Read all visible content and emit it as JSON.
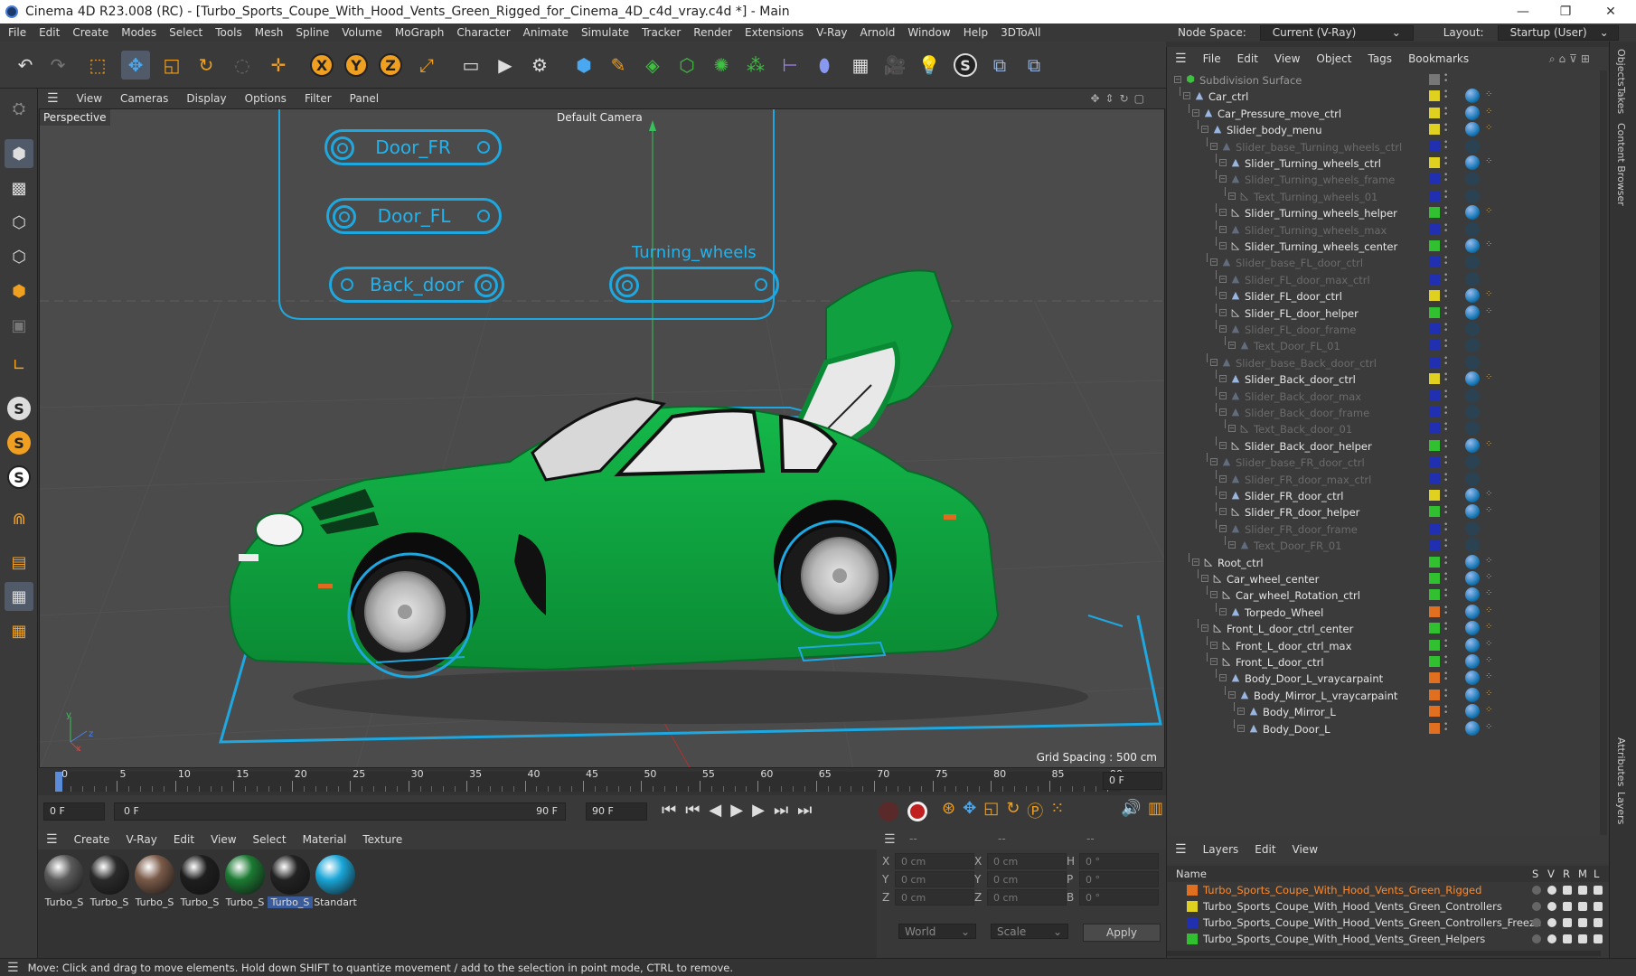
{
  "window": {
    "title": "Cinema 4D R23.008 (RC) - [Turbo_Sports_Coupe_With_Hood_Vents_Green_Rigged_for_Cinema_4D_c4d_vray.c4d *] - Main",
    "minimize": "—",
    "maximize": "❐",
    "close": "✕"
  },
  "menubar": {
    "items": [
      "File",
      "Edit",
      "Create",
      "Modes",
      "Select",
      "Tools",
      "Mesh",
      "Spline",
      "Volume",
      "MoGraph",
      "Character",
      "Animate",
      "Simulate",
      "Tracker",
      "Render",
      "Extensions",
      "V-Ray",
      "Arnold",
      "Window",
      "Help",
      "3DToAll"
    ],
    "node_space_label": "Node Space:",
    "node_space_value": "Current (V-Ray)",
    "layout_label": "Layout:",
    "layout_value": "Startup (User)"
  },
  "viewport": {
    "menu": [
      "View",
      "Cameras",
      "Display",
      "Options",
      "Filter",
      "Panel"
    ],
    "name": "Perspective",
    "camera": "Default Camera",
    "grid_spacing": "Grid Spacing : 500 cm",
    "controls": {
      "door_fr": "Door_FR",
      "door_fl": "Door_FL",
      "back_door": "Back_door",
      "turning_wheels": "Turning_wheels"
    }
  },
  "timeline": {
    "ticks": [
      "0",
      "5",
      "10",
      "15",
      "20",
      "25",
      "30",
      "35",
      "40",
      "45",
      "50",
      "55",
      "60",
      "65",
      "70",
      "75",
      "80",
      "85",
      "90"
    ],
    "current_frame": "0 F",
    "start_frame": "0 F",
    "range_start": "0 F",
    "range_end": "90 F",
    "end_frame": "90 F"
  },
  "materials": {
    "menu": [
      "Create",
      "V-Ray",
      "Edit",
      "View",
      "Select",
      "Material",
      "Texture"
    ],
    "items": [
      {
        "label": "Turbo_S",
        "color": "#5a5a5a"
      },
      {
        "label": "Turbo_S",
        "color": "#2a2a2a"
      },
      {
        "label": "Turbo_S",
        "color": "#7a5a48"
      },
      {
        "label": "Turbo_S",
        "color": "#1e1e1e"
      },
      {
        "label": "Turbo_S",
        "color": "#1b7a32"
      },
      {
        "label": "Turbo_S",
        "color": "#222222"
      },
      {
        "label": "Standart",
        "color": "#1aa6d8"
      }
    ],
    "selected_index": 5
  },
  "coords": {
    "header": "--",
    "header2": "--",
    "header3": "--",
    "rows": [
      {
        "a": "X",
        "av": "0 cm",
        "b": "X",
        "bv": "0 cm",
        "c": "H",
        "cv": "0 °"
      },
      {
        "a": "Y",
        "av": "0 cm",
        "b": "Y",
        "bv": "0 cm",
        "c": "P",
        "cv": "0 °"
      },
      {
        "a": "Z",
        "av": "0 cm",
        "b": "Z",
        "bv": "0 cm",
        "c": "B",
        "cv": "0 °"
      }
    ],
    "world": "World",
    "scale": "Scale",
    "apply": "Apply"
  },
  "status": "Move: Click and drag to move elements. Hold down SHIFT to quantize movement / add to the selection in point mode, CTRL to remove.",
  "object_manager": {
    "menu": [
      "File",
      "Edit",
      "View",
      "Object",
      "Tags",
      "Bookmarks"
    ],
    "rows": [
      {
        "name": "Subdivision Surface",
        "depth": 0,
        "dim": false,
        "layer": "#888888",
        "icon": "subd"
      },
      {
        "name": "Car_ctrl",
        "depth": 1,
        "dim": false,
        "layer": "#e0d020",
        "icon": "null"
      },
      {
        "name": "Car_Pressure_move_ctrl",
        "depth": 2,
        "dim": false,
        "layer": "#e0d020",
        "icon": "null"
      },
      {
        "name": "Slider_body_menu",
        "depth": 3,
        "dim": false,
        "layer": "#e0d020",
        "icon": "null"
      },
      {
        "name": "Slider_base_Turning_wheels_ctrl",
        "depth": 4,
        "dim": true,
        "layer": "#2030b0",
        "icon": "null"
      },
      {
        "name": "Slider_Turning_wheels_ctrl",
        "depth": 5,
        "dim": false,
        "layer": "#e0d020",
        "icon": "null"
      },
      {
        "name": "Slider_Turning_wheels_frame",
        "depth": 5,
        "dim": true,
        "layer": "#2030b0",
        "icon": "null"
      },
      {
        "name": "Text_Turning_wheels_01",
        "depth": 6,
        "dim": true,
        "layer": "#2030b0",
        "icon": "spline"
      },
      {
        "name": "Slider_Turning_wheels_helper",
        "depth": 5,
        "dim": false,
        "layer": "#30c030",
        "icon": "spline"
      },
      {
        "name": "Slider_Turning_wheels_max",
        "depth": 5,
        "dim": true,
        "layer": "#2030b0",
        "icon": "null"
      },
      {
        "name": "Slider_Turning_wheels_center",
        "depth": 5,
        "dim": false,
        "layer": "#30c030",
        "icon": "spline"
      },
      {
        "name": "Slider_base_FL_door_ctrl",
        "depth": 4,
        "dim": true,
        "layer": "#2030b0",
        "icon": "null"
      },
      {
        "name": "Slider_FL_door_max_ctrl",
        "depth": 5,
        "dim": true,
        "layer": "#2030b0",
        "icon": "null"
      },
      {
        "name": "Slider_FL_door_ctrl",
        "depth": 5,
        "dim": false,
        "layer": "#e0d020",
        "icon": "null"
      },
      {
        "name": "Slider_FL_door_helper",
        "depth": 5,
        "dim": false,
        "layer": "#30c030",
        "icon": "spline"
      },
      {
        "name": "Slider_FL_door_frame",
        "depth": 5,
        "dim": true,
        "layer": "#2030b0",
        "icon": "null"
      },
      {
        "name": "Text_Door_FL_01",
        "depth": 6,
        "dim": true,
        "layer": "#2030b0",
        "icon": "null"
      },
      {
        "name": "Slider_base_Back_door_ctrl",
        "depth": 4,
        "dim": true,
        "layer": "#2030b0",
        "icon": "null"
      },
      {
        "name": "Slider_Back_door_ctrl",
        "depth": 5,
        "dim": false,
        "layer": "#e0d020",
        "icon": "null"
      },
      {
        "name": "Slider_Back_door_max",
        "depth": 5,
        "dim": true,
        "layer": "#2030b0",
        "icon": "null"
      },
      {
        "name": "Slider_Back_door_frame",
        "depth": 5,
        "dim": true,
        "layer": "#2030b0",
        "icon": "null"
      },
      {
        "name": "Text_Back_door_01",
        "depth": 6,
        "dim": true,
        "layer": "#2030b0",
        "icon": "spline"
      },
      {
        "name": "Slider_Back_door_helper",
        "depth": 5,
        "dim": false,
        "layer": "#30c030",
        "icon": "spline"
      },
      {
        "name": "Slider_base_FR_door_ctrl",
        "depth": 4,
        "dim": true,
        "layer": "#2030b0",
        "icon": "null"
      },
      {
        "name": "Slider_FR_door_max_ctrl",
        "depth": 5,
        "dim": true,
        "layer": "#2030b0",
        "icon": "null"
      },
      {
        "name": "Slider_FR_door_ctrl",
        "depth": 5,
        "dim": false,
        "layer": "#e0d020",
        "icon": "null"
      },
      {
        "name": "Slider_FR_door_helper",
        "depth": 5,
        "dim": false,
        "layer": "#30c030",
        "icon": "spline"
      },
      {
        "name": "Slider_FR_door_frame",
        "depth": 5,
        "dim": true,
        "layer": "#2030b0",
        "icon": "null"
      },
      {
        "name": "Text_Door_FR_01",
        "depth": 6,
        "dim": true,
        "layer": "#2030b0",
        "icon": "null"
      },
      {
        "name": "Root_ctrl",
        "depth": 2,
        "dim": false,
        "layer": "#30c030",
        "icon": "spline"
      },
      {
        "name": "Car_wheel_center",
        "depth": 3,
        "dim": false,
        "layer": "#30c030",
        "icon": "spline"
      },
      {
        "name": "Car_wheel_Rotation_ctrl",
        "depth": 4,
        "dim": false,
        "layer": "#30c030",
        "icon": "spline"
      },
      {
        "name": "Torpedo_Wheel",
        "depth": 5,
        "dim": false,
        "layer": "#e07020",
        "icon": "null"
      },
      {
        "name": "Front_L_door_ctrl_center",
        "depth": 3,
        "dim": false,
        "layer": "#30c030",
        "icon": "spline"
      },
      {
        "name": "Front_L_door_ctrl_max",
        "depth": 4,
        "dim": false,
        "layer": "#30c030",
        "icon": "spline"
      },
      {
        "name": "Front_L_door_ctrl",
        "depth": 4,
        "dim": false,
        "layer": "#30c030",
        "icon": "spline"
      },
      {
        "name": "Body_Door_L_vraycarpaint",
        "depth": 5,
        "dim": false,
        "layer": "#e07020",
        "icon": "null"
      },
      {
        "name": "Body_Mirror_L_vraycarpaint",
        "depth": 6,
        "dim": false,
        "layer": "#e07020",
        "icon": "null"
      },
      {
        "name": "Body_Mirror_L",
        "depth": 7,
        "dim": false,
        "layer": "#e07020",
        "icon": "null"
      },
      {
        "name": "Body_Door_L",
        "depth": 7,
        "dim": false,
        "layer": "#e07020",
        "icon": "null"
      }
    ]
  },
  "layers": {
    "menu": [
      "Layers",
      "Edit",
      "View"
    ],
    "col_name": "Name",
    "cols": [
      "S",
      "V",
      "R",
      "M",
      "L"
    ],
    "rows": [
      {
        "name": "Turbo_Sports_Coupe_With_Hood_Vents_Green_Rigged",
        "color": "#e07020",
        "text_color": "#ff8a2a"
      },
      {
        "name": "Turbo_Sports_Coupe_With_Hood_Vents_Green_Controllers",
        "color": "#e0d020",
        "text_color": "#dddddd"
      },
      {
        "name": "Turbo_Sports_Coupe_With_Hood_Vents_Green_Controllers_Freeze",
        "color": "#2030b0",
        "text_color": "#dddddd"
      },
      {
        "name": "Turbo_Sports_Coupe_With_Hood_Vents_Green_Helpers",
        "color": "#30c030",
        "text_color": "#dddddd"
      }
    ]
  },
  "right_tabs": [
    "Objects",
    "Takes",
    "Content Browser",
    "Attributes",
    "Layers"
  ]
}
